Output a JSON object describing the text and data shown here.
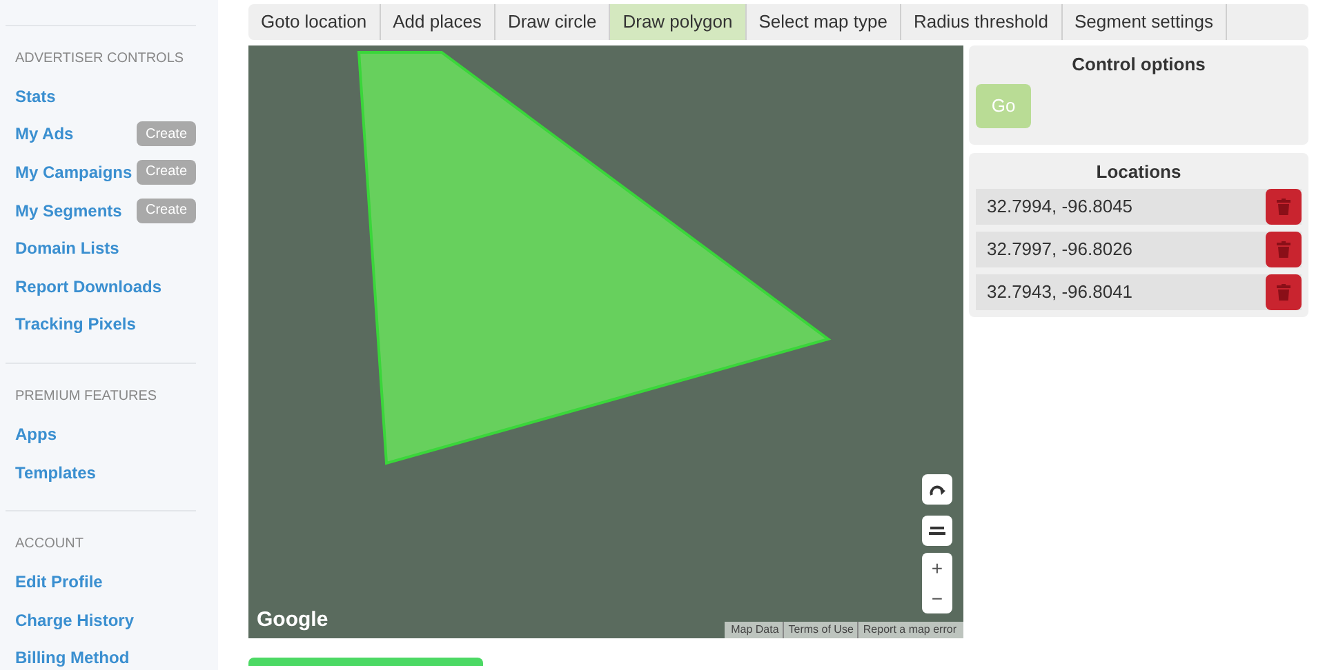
{
  "sidebar": {
    "sections": [
      {
        "heading": "ADVERTISER CONTROLS",
        "items": [
          {
            "label": "Stats"
          },
          {
            "label": "My Ads",
            "action": "Create"
          },
          {
            "label": "My Campaigns",
            "action": "Create"
          },
          {
            "label": "My Segments",
            "action": "Create"
          },
          {
            "label": "Domain Lists"
          },
          {
            "label": "Report Downloads"
          },
          {
            "label": "Tracking Pixels"
          }
        ]
      },
      {
        "heading": "PREMIUM FEATURES",
        "items": [
          {
            "label": "Apps"
          },
          {
            "label": "Templates"
          }
        ]
      },
      {
        "heading": "ACCOUNT",
        "items": [
          {
            "label": "Edit Profile"
          },
          {
            "label": "Charge History"
          },
          {
            "label": "Billing Method"
          }
        ]
      }
    ]
  },
  "tabs": [
    {
      "label": "Goto location",
      "selected": false
    },
    {
      "label": "Add places",
      "selected": false
    },
    {
      "label": "Draw circle",
      "selected": false
    },
    {
      "label": "Draw polygon",
      "selected": true
    },
    {
      "label": "Select map type",
      "selected": false
    },
    {
      "label": "Radius threshold",
      "selected": false
    },
    {
      "label": "Segment settings",
      "selected": false
    }
  ],
  "map": {
    "controls": [
      "+",
      "−"
    ],
    "footer": [
      "Map Data",
      "Terms of Use",
      "Report a map error"
    ],
    "logo": "Google"
  },
  "control_options": {
    "title": "Control options",
    "button": "Go"
  },
  "locations": {
    "title": "Locations",
    "items": [
      "32.7994, -96.8045",
      "32.7997, -96.8026",
      "32.7943, -96.8041"
    ]
  }
}
